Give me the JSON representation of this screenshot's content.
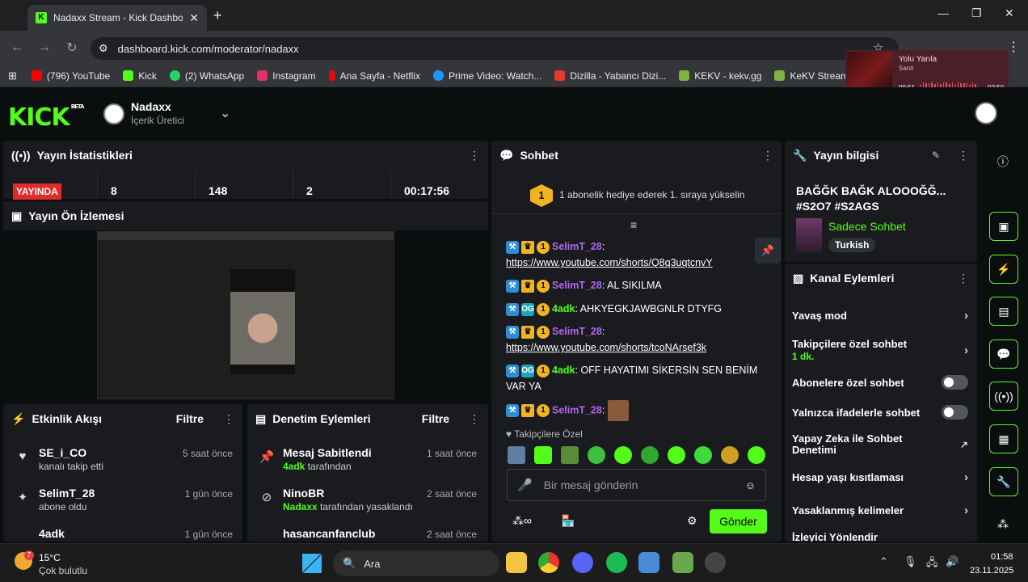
{
  "browser": {
    "tab_title": "Nadaxx Stream - Kick Dashboar",
    "tab_close": "✕",
    "new_tab": "+",
    "url": "dashboard.kick.com/moderator/nadaxx",
    "bookmarks": [
      {
        "label": "(796) YouTube",
        "color": "#ff0000"
      },
      {
        "label": "Kick",
        "color": "#53fc18"
      },
      {
        "label": "(2) WhatsApp",
        "color": "#25d366"
      },
      {
        "label": "Instagram",
        "color": "#e1306c"
      },
      {
        "label": "Ana Sayfa - Netflix",
        "color": "#e50914"
      },
      {
        "label": "Prime Video: Watch...",
        "color": "#1a98ff"
      },
      {
        "label": "Dizilla - Yabancı Dizi...",
        "color": "#e53935"
      },
      {
        "label": "KEKV - kekv.gg",
        "color": "#7cb342"
      },
      {
        "label": "KeKV Streamer Hub",
        "color": "#7cb342"
      }
    ],
    "media": {
      "title": "Yolu Yarıla",
      "artist": "Santi",
      "elapsed": "00:51",
      "total": "02:50",
      "progress": 0.3
    }
  },
  "header": {
    "logo": "KICK",
    "logo_tag": "BETA",
    "channel_name": "Nadaxx",
    "channel_role": "İçerik Üretici"
  },
  "stats": {
    "title": "Yayın İstatistikleri",
    "live_label": "YAYINDA",
    "values": [
      "8",
      "148",
      "2",
      "00:17:56"
    ]
  },
  "preview": {
    "title": "Yayın Ön İzlemesi"
  },
  "activity": {
    "title": "Etkinlik Akışı",
    "filter": "Filtre",
    "items": [
      {
        "name": "SE_i_CO",
        "sub": "kanalı takip etti",
        "time": "5 saat önce"
      },
      {
        "name": "SelimT_28",
        "sub": "abone oldu",
        "time": "1 gün önce"
      },
      {
        "name": "4adk",
        "sub": "",
        "time": "1 gün önce"
      }
    ]
  },
  "modlog": {
    "title": "Denetim Eylemleri",
    "filter": "Filtre",
    "items": [
      {
        "name": "Mesaj Sabitlendi",
        "actor": "4adk",
        "sub": " tarafından",
        "time": "1 saat önce"
      },
      {
        "name": "NinoBR",
        "actor": "Nadaxx",
        "sub": " tarafından yasaklandı",
        "time": "2 saat önce"
      },
      {
        "name": "hasancanfanclub",
        "actor": "",
        "sub": "",
        "time": "2 saat önce"
      }
    ]
  },
  "chat": {
    "title": "Sohbet",
    "gift_text": "1 abonelik hediye ederek 1. sıraya yükselin",
    "gift_rank": "1",
    "messages": [
      {
        "user": "SelimT_28",
        "color": "#b565f5",
        "text": "",
        "link": "https://www.youtube.com/shorts/Q8q3uqtcnvY",
        "og": false
      },
      {
        "user": "SelimT_28",
        "color": "#b565f5",
        "text": "AL SIKILMA",
        "link": "",
        "og": false
      },
      {
        "user": "4adk",
        "color": "#53fc18",
        "text": "AHKYEGKJAWBGNLR DTYFG",
        "link": "",
        "og": true
      },
      {
        "user": "SelimT_28",
        "color": "#b565f5",
        "text": "",
        "link": "https://www.youtube.com/shorts/tcoNArsef3k",
        "og": false
      },
      {
        "user": "4adk",
        "color": "#53fc18",
        "text": "OFF HAYATIMI SİKERSİN SEN BENİM VAR YA",
        "link": "",
        "og": true
      },
      {
        "user": "SelimT_28",
        "color": "#b565f5",
        "text": "",
        "link": "",
        "og": false
      }
    ],
    "followers_only": "Takipçilere Özel",
    "input_placeholder": "Bir mesaj gönderin",
    "send_label": "Gönder",
    "badge_one": "1"
  },
  "stream_info": {
    "title": "Yayın bilgisi",
    "stream_title": "BAĞĞK BAĞK ALOOOĞĞ... #S2O7 #S2AGS",
    "category": "Sadece Sohbet",
    "language": "Turkish"
  },
  "channel_actions": {
    "title": "Kanal Eylemleri",
    "items": [
      {
        "label": "Yavaş mod",
        "type": "arrow"
      },
      {
        "label": "Takipçilere özel sohbet",
        "sub": "1 dk.",
        "type": "arrow"
      },
      {
        "label": "Abonelere özel sohbet",
        "type": "toggle"
      },
      {
        "label": "Yalnızca ifadelerle sohbet",
        "type": "toggle"
      },
      {
        "label": "Yapay Zeka ile Sohbet Denetimi",
        "type": "external"
      },
      {
        "label": "Hesap yaşı kısıtlaması",
        "type": "arrow"
      },
      {
        "label": "Yasaklanmış kelimeler",
        "type": "arrow"
      },
      {
        "label": "İzleyici Yönlendir",
        "type": "arrow"
      }
    ]
  },
  "taskbar": {
    "weather_temp": "15°C",
    "weather_desc": "Çok bulutlu",
    "weather_badge": "7",
    "search_label": "Ara",
    "time": "01:58",
    "date": "23.11.2025"
  }
}
